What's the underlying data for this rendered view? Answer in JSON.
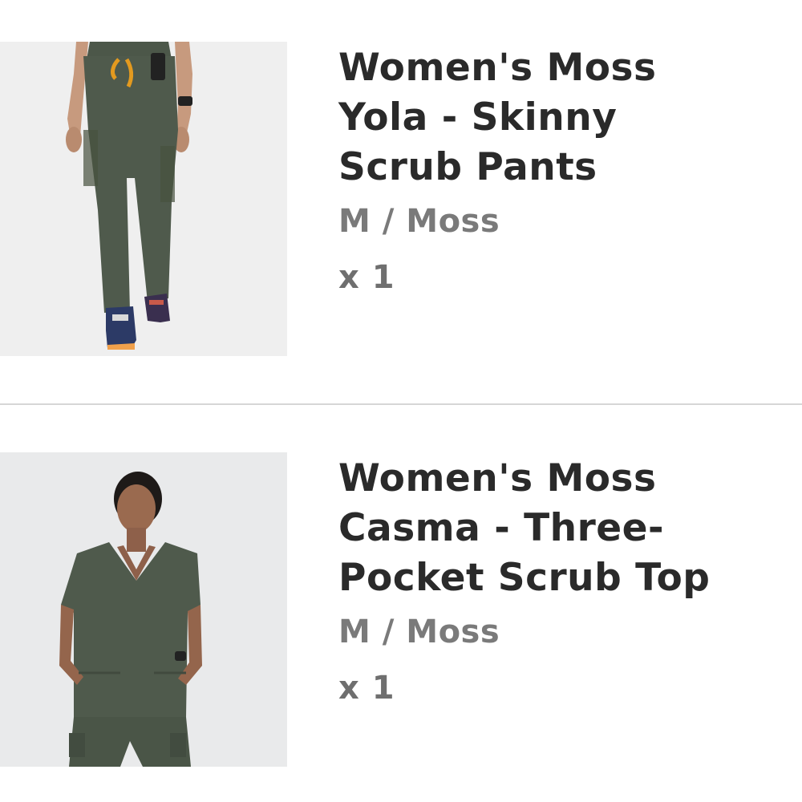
{
  "cart": {
    "items": [
      {
        "title": "Women's Moss\nYola - Skinny\nScrub Pants",
        "variant": "M / Moss",
        "quantity": "x 1",
        "image_icon": "scrub-pants-photo"
      },
      {
        "title": "Women's Moss\nCasma - Three-\nPocket Scrub Top",
        "variant": "M / Moss",
        "quantity": "x 1",
        "image_icon": "scrub-top-photo"
      }
    ]
  },
  "colors": {
    "moss": "#4f5a4c",
    "title_text": "#2a2a2a",
    "secondary_text": "#7a7a7a",
    "divider": "#d6d6d6"
  }
}
